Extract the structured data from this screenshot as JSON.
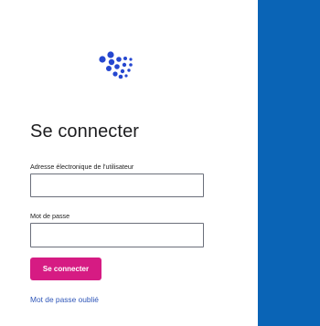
{
  "login": {
    "title": "Se connecter",
    "email_label": "Adresse électronique de l'utilisateur",
    "email_value": "",
    "password_label": "Mot de passe",
    "password_value": "",
    "submit_label": "Se connecter",
    "forgot_password_link": "Mot de passe oublié"
  },
  "logo": {
    "icon": "dot-cluster-logo-icon",
    "color": "#2547d0"
  },
  "colors": {
    "primary_button": "#d61b83",
    "link": "#2f56b8",
    "brand_panel": "#0a64b6",
    "input_border": "#6b6f7b"
  }
}
